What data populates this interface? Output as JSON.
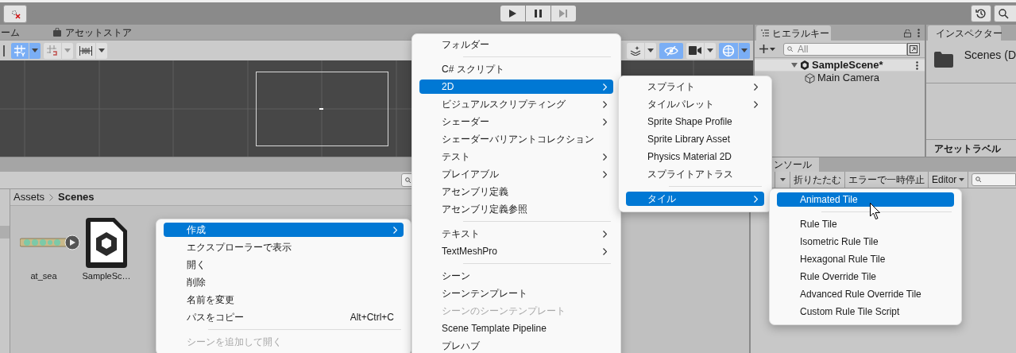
{
  "editor_tabs": [
    {
      "label": "ーム",
      "kind": "game"
    },
    {
      "label": "アセットストア",
      "kind": "store"
    }
  ],
  "scene_toolbar": {
    "left": [
      {
        "kind": "grid",
        "on": true
      },
      {
        "kind": "snap",
        "on": false
      },
      {
        "kind": "ruler",
        "on": false
      }
    ],
    "right": [
      {
        "kind": "layers",
        "on": false
      },
      {
        "kind": "visibility",
        "on": true
      },
      {
        "kind": "camera",
        "on": false
      },
      {
        "kind": "gizmos",
        "on": true
      }
    ]
  },
  "hierarchy": {
    "tab": "ヒエラルキー",
    "search_placeholder": "All",
    "items": [
      {
        "label": "SampleScene*",
        "expanded": true,
        "children": [
          {
            "label": "Main Camera"
          }
        ]
      }
    ]
  },
  "inspector": {
    "tab": "インスペクター",
    "title": "Scenes (D",
    "section": "アセットラベル"
  },
  "project": {
    "breadcrumb": [
      "Assets",
      "Scenes"
    ],
    "assets": [
      {
        "name": "at_sea",
        "kind": "audio"
      },
      {
        "name": "SampleSc…",
        "kind": "scene"
      }
    ]
  },
  "console": {
    "tab": "ンソール",
    "buttons": [
      "折りたたむ",
      "エラーで一時停止"
    ],
    "dropdown": "Editor"
  },
  "context_menus": [
    {
      "items": [
        {
          "kind": "item",
          "label": "作成",
          "submenu": true,
          "selected": true,
          "disabled": false
        },
        {
          "kind": "item",
          "label": "エクスプローラーで表示",
          "submenu": false,
          "selected": false,
          "disabled": false
        },
        {
          "kind": "item",
          "label": "開く",
          "submenu": false,
          "selected": false,
          "disabled": false
        },
        {
          "kind": "item",
          "label": "削除",
          "submenu": false,
          "selected": false,
          "disabled": false
        },
        {
          "kind": "item",
          "label": "名前を変更",
          "submenu": false,
          "selected": false,
          "disabled": false
        },
        {
          "kind": "item",
          "label": "パスをコピー",
          "shortcut": "Alt+Ctrl+C",
          "submenu": false,
          "selected": false,
          "disabled": false
        },
        {
          "kind": "separator"
        },
        {
          "kind": "item",
          "label": "シーンを追加して開く",
          "submenu": false,
          "selected": false,
          "disabled": true
        }
      ]
    },
    {
      "items": [
        {
          "kind": "item",
          "label": "フォルダー",
          "submenu": false,
          "selected": false,
          "disabled": false
        },
        {
          "kind": "separator"
        },
        {
          "kind": "item",
          "label": "C# スクリプト",
          "submenu": false,
          "selected": false,
          "disabled": false
        },
        {
          "kind": "item",
          "label": "2D",
          "submenu": true,
          "selected": true,
          "disabled": false
        },
        {
          "kind": "item",
          "label": "ビジュアルスクリプティング",
          "submenu": true,
          "selected": false,
          "disabled": false
        },
        {
          "kind": "item",
          "label": "シェーダー",
          "submenu": true,
          "selected": false,
          "disabled": false
        },
        {
          "kind": "item",
          "label": "シェーダーバリアントコレクション",
          "submenu": false,
          "selected": false,
          "disabled": false
        },
        {
          "kind": "item",
          "label": "テスト",
          "submenu": true,
          "selected": false,
          "disabled": false
        },
        {
          "kind": "item",
          "label": "プレイアブル",
          "submenu": true,
          "selected": false,
          "disabled": false
        },
        {
          "kind": "item",
          "label": "アセンブリ定義",
          "submenu": false,
          "selected": false,
          "disabled": false
        },
        {
          "kind": "item",
          "label": "アセンブリ定義参照",
          "submenu": false,
          "selected": false,
          "disabled": false
        },
        {
          "kind": "separator"
        },
        {
          "kind": "item",
          "label": "テキスト",
          "submenu": true,
          "selected": false,
          "disabled": false
        },
        {
          "kind": "item",
          "label": "TextMeshPro",
          "submenu": true,
          "selected": false,
          "disabled": false
        },
        {
          "kind": "separator"
        },
        {
          "kind": "item",
          "label": "シーン",
          "submenu": false,
          "selected": false,
          "disabled": false
        },
        {
          "kind": "item",
          "label": "シーンテンプレート",
          "submenu": false,
          "selected": false,
          "disabled": false
        },
        {
          "kind": "item",
          "label": "シーンのシーンテンプレート",
          "submenu": false,
          "selected": false,
          "disabled": true
        },
        {
          "kind": "item",
          "label": "Scene Template Pipeline",
          "submenu": false,
          "selected": false,
          "disabled": false
        },
        {
          "kind": "item",
          "label": "プレハブ",
          "submenu": false,
          "selected": false,
          "disabled": false
        }
      ]
    },
    {
      "items": [
        {
          "kind": "item",
          "label": "スプライト",
          "submenu": true,
          "selected": false,
          "disabled": false
        },
        {
          "kind": "item",
          "label": "タイルパレット",
          "submenu": true,
          "selected": false,
          "disabled": false
        },
        {
          "kind": "item",
          "label": "Sprite Shape Profile",
          "submenu": false,
          "selected": false,
          "disabled": false
        },
        {
          "kind": "item",
          "label": "Sprite Library Asset",
          "submenu": false,
          "selected": false,
          "disabled": false
        },
        {
          "kind": "item",
          "label": "Physics Material 2D",
          "submenu": false,
          "selected": false,
          "disabled": false
        },
        {
          "kind": "item",
          "label": "スプライトアトラス",
          "submenu": false,
          "selected": false,
          "disabled": false
        },
        {
          "kind": "separator"
        },
        {
          "kind": "item",
          "label": "タイル",
          "submenu": true,
          "selected": true,
          "disabled": false
        }
      ]
    },
    {
      "items": [
        {
          "kind": "item",
          "label": "Animated Tile",
          "submenu": false,
          "selected": true,
          "disabled": false
        },
        {
          "kind": "separator"
        },
        {
          "kind": "item",
          "label": "Rule Tile",
          "submenu": false,
          "selected": false,
          "disabled": false
        },
        {
          "kind": "item",
          "label": "Isometric Rule Tile",
          "submenu": false,
          "selected": false,
          "disabled": false
        },
        {
          "kind": "item",
          "label": "Hexagonal Rule Tile",
          "submenu": false,
          "selected": false,
          "disabled": false
        },
        {
          "kind": "item",
          "label": "Rule Override Tile",
          "submenu": false,
          "selected": false,
          "disabled": false
        },
        {
          "kind": "item",
          "label": "Advanced Rule Override Tile",
          "submenu": false,
          "selected": false,
          "disabled": false
        },
        {
          "kind": "item",
          "label": "Custom Rule Tile Script",
          "submenu": false,
          "selected": false,
          "disabled": false
        }
      ]
    }
  ]
}
